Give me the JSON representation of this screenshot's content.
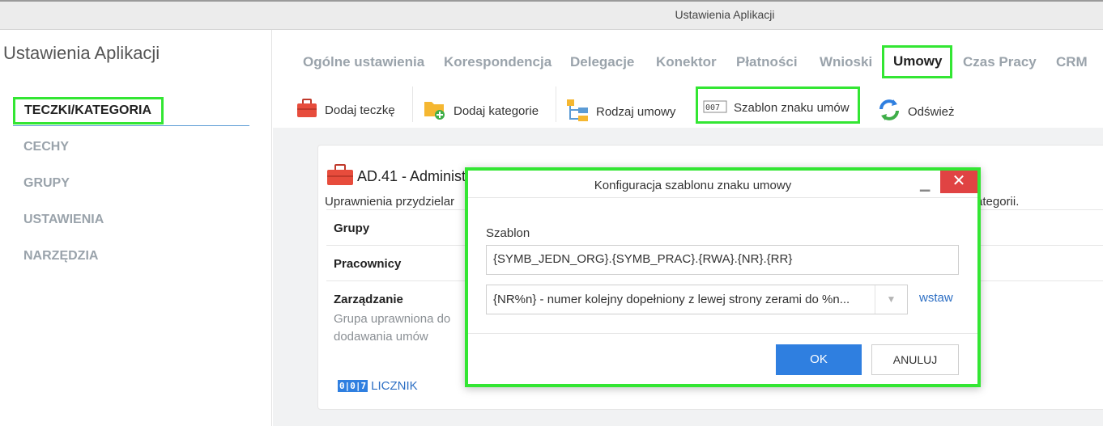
{
  "window": {
    "title": "Ustawienia Aplikacji"
  },
  "sidebar": {
    "heading": "Ustawienia Aplikacji",
    "items": [
      {
        "label": "TECZKI/KATEGORIA",
        "active": true
      },
      {
        "label": "CECHY"
      },
      {
        "label": "GRUPY"
      },
      {
        "label": "USTAWIENIA"
      },
      {
        "label": "NARZĘDZIA"
      }
    ]
  },
  "tabs": [
    {
      "label": "Ogólne ustawienia"
    },
    {
      "label": "Korespondencja"
    },
    {
      "label": "Delegacje"
    },
    {
      "label": "Konektor"
    },
    {
      "label": "Płatności"
    },
    {
      "label": "Wnioski"
    },
    {
      "label": "Umowy",
      "active": true
    },
    {
      "label": "Czas Pracy"
    },
    {
      "label": "CRM"
    }
  ],
  "toolbar": {
    "add_folder": "Dodaj teczkę",
    "add_category": "Dodaj kategorie",
    "contract_type": "Rodzaj umowy",
    "sign_template": "Szablon znaku umów",
    "refresh": "Odśwież"
  },
  "card": {
    "title": "AD.41 - Administ",
    "description_left": "Uprawnienia przydzielar",
    "description_right": "ategorii.",
    "rows": [
      {
        "label": "Grupy"
      },
      {
        "label": "Pracownicy"
      },
      {
        "label": "Zarządzanie",
        "sub": "Grupa uprawniona do dodawania umów"
      }
    ],
    "counter_icon_text": "0|0|7",
    "counter_label": "LICZNIK"
  },
  "dialog": {
    "title": "Konfiguracja szablonu znaku umowy",
    "template_label": "Szablon",
    "template_value": "{SYMB_JEDN_ORG}.{SYMB_PRAC}.{RWA}.{NR}.{RR}",
    "select_value": "{NR%n} - numer kolejny dopełniony z lewej strony zerami do %n...",
    "insert_link": "wstaw",
    "ok_button": "OK",
    "cancel_button": "ANULUJ"
  },
  "colors": {
    "highlight": "#33e633",
    "primary": "#2f7fe0",
    "close": "#e04343"
  }
}
